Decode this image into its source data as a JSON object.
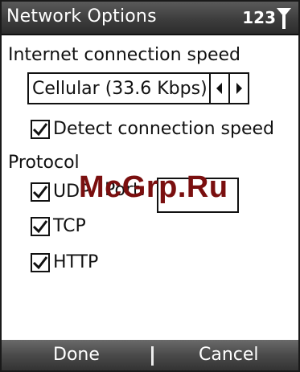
{
  "titlebar": {
    "title": "Network Options",
    "indicator": "123"
  },
  "connection": {
    "section_label": "Internet connection speed",
    "speed_value": "Cellular (33.6 Kbps)",
    "detect_label": "Detect connection speed",
    "detect_checked": true
  },
  "protocol": {
    "section_label": "Protocol",
    "items": [
      {
        "label": "UDP",
        "checked": true
      },
      {
        "label": "TCP",
        "checked": true
      },
      {
        "label": "HTTP",
        "checked": true
      }
    ],
    "port_label": "Port:"
  },
  "watermark": "McGrp.Ru",
  "softkeys": {
    "left": "Done",
    "right": "Cancel"
  }
}
